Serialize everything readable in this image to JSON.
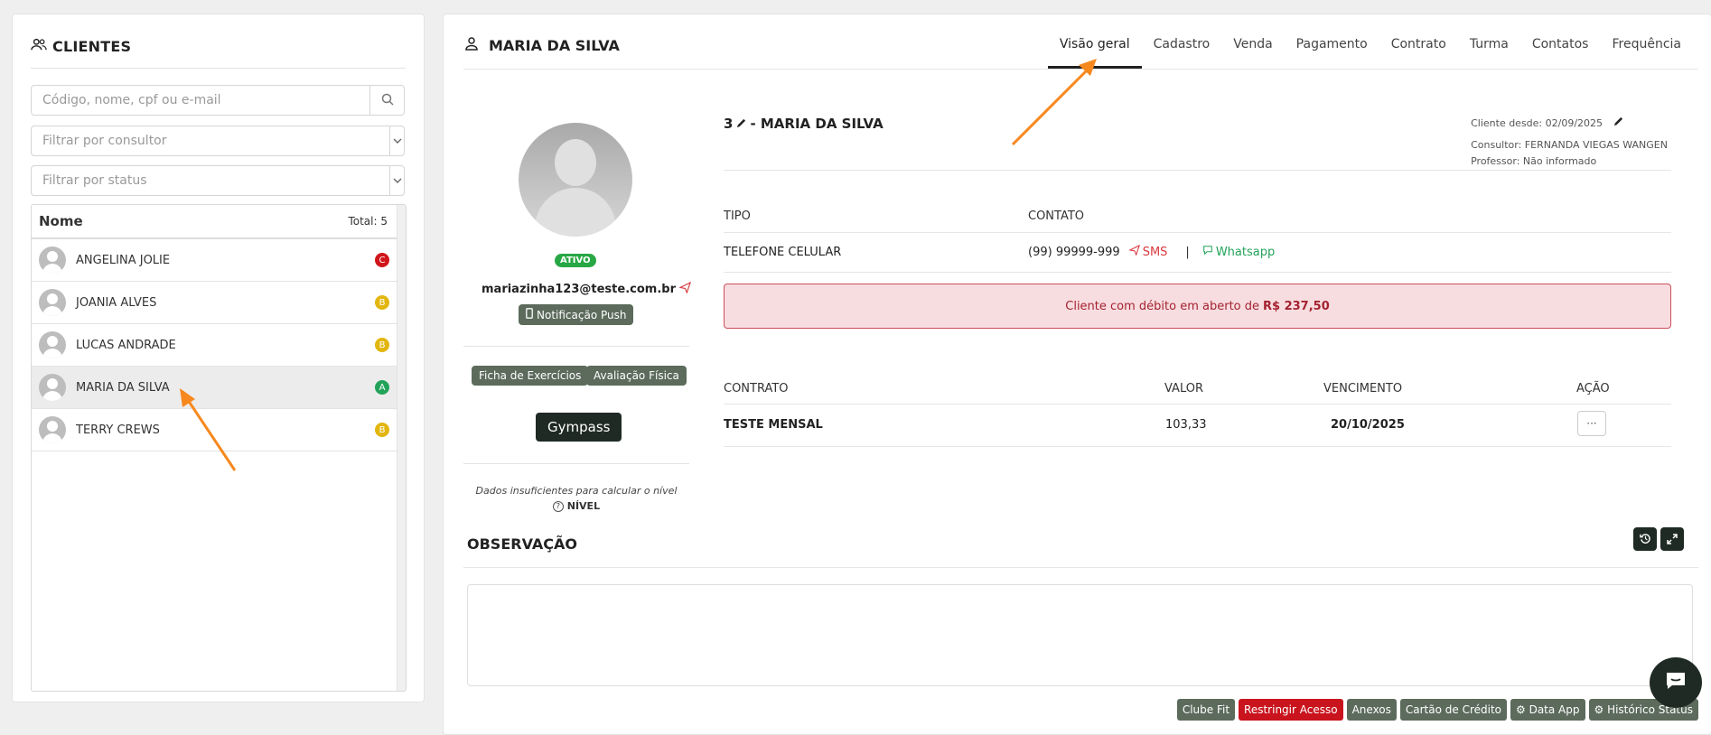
{
  "sidebar": {
    "title": "CLIENTES",
    "search_placeholder": "Código, nome, cpf ou e-mail",
    "consultant_filter": "Filtrar por consultor",
    "status_filter": "Filtrar por status",
    "list_header": {
      "name": "Nome",
      "total": "Total: 5"
    },
    "clients": [
      {
        "name": "ANGELINA JOLIE",
        "badge": "C",
        "badge_color": "#d0151b"
      },
      {
        "name": "JOANIA ALVES",
        "badge": "B",
        "badge_color": "#e2b60f"
      },
      {
        "name": "LUCAS ANDRADE",
        "badge": "B",
        "badge_color": "#e2b60f"
      },
      {
        "name": "MARIA DA SILVA",
        "badge": "A",
        "badge_color": "#23a35a",
        "selected": true
      },
      {
        "name": "TERRY CREWS",
        "badge": "B",
        "badge_color": "#e2b60f"
      }
    ]
  },
  "header": {
    "client_name": "MARIA DA SILVA",
    "tabs": [
      "Visão geral",
      "Cadastro",
      "Venda",
      "Pagamento",
      "Contrato",
      "Turma",
      "Contatos",
      "Frequência"
    ],
    "active_tab": "Visão geral"
  },
  "profile": {
    "status": "ATIVO",
    "email": "mariazinha123@teste.com.br",
    "push_button": "Notificação Push",
    "ficha_button": "Ficha de Exercícios",
    "avaliacao_button": "Avaliação Física",
    "gympass_button": "Gympass",
    "level_text": "Dados insuficientes para calcular o nível",
    "level_label": "NÍVEL"
  },
  "client_info": {
    "code": "3",
    "name": "- MARIA DA SILVA",
    "since": "Cliente desde: 02/09/2025",
    "consultant": "Consultor: FERNANDA VIEGAS WANGEN",
    "teacher": "Professor: Não informado"
  },
  "contacts": {
    "col_type": "TIPO",
    "col_contact": "CONTATO",
    "row": {
      "type": "TELEFONE CELULAR",
      "phone": "(99) 99999-999",
      "sms": "SMS",
      "divider": "|",
      "whatsapp": "Whatsapp"
    }
  },
  "debt_alert": {
    "text": "Cliente com débito em aberto de",
    "amount": "R$ 237,50",
    "bg_color": "#f8dde0",
    "border_color": "#cc4e5a"
  },
  "contracts": {
    "columns": [
      "CONTRATO",
      "VALOR",
      "VENCIMENTO",
      "AÇÃO"
    ],
    "rows": [
      {
        "name": "TESTE MENSAL",
        "value": "103,33",
        "due": "20/10/2025",
        "action": "···"
      }
    ]
  },
  "observation": {
    "title": "OBSERVAÇÃO"
  },
  "bottom_buttons": [
    {
      "label": "Clube Fit",
      "style": "default"
    },
    {
      "label": "Restringir Acesso",
      "style": "red"
    },
    {
      "label": "Anexos",
      "style": "default"
    },
    {
      "label": "Cartão de Crédito",
      "style": "default"
    },
    {
      "label": "⚙ Data App",
      "style": "default"
    },
    {
      "label": "⚙ Histórico Status",
      "style": "default"
    }
  ],
  "colors": {
    "accent_dark": "#1f2a24",
    "button_gray": "#5c6b5c",
    "success": "#28a745",
    "danger": "#c9141e",
    "annotation_arrow": "#f7881e"
  }
}
